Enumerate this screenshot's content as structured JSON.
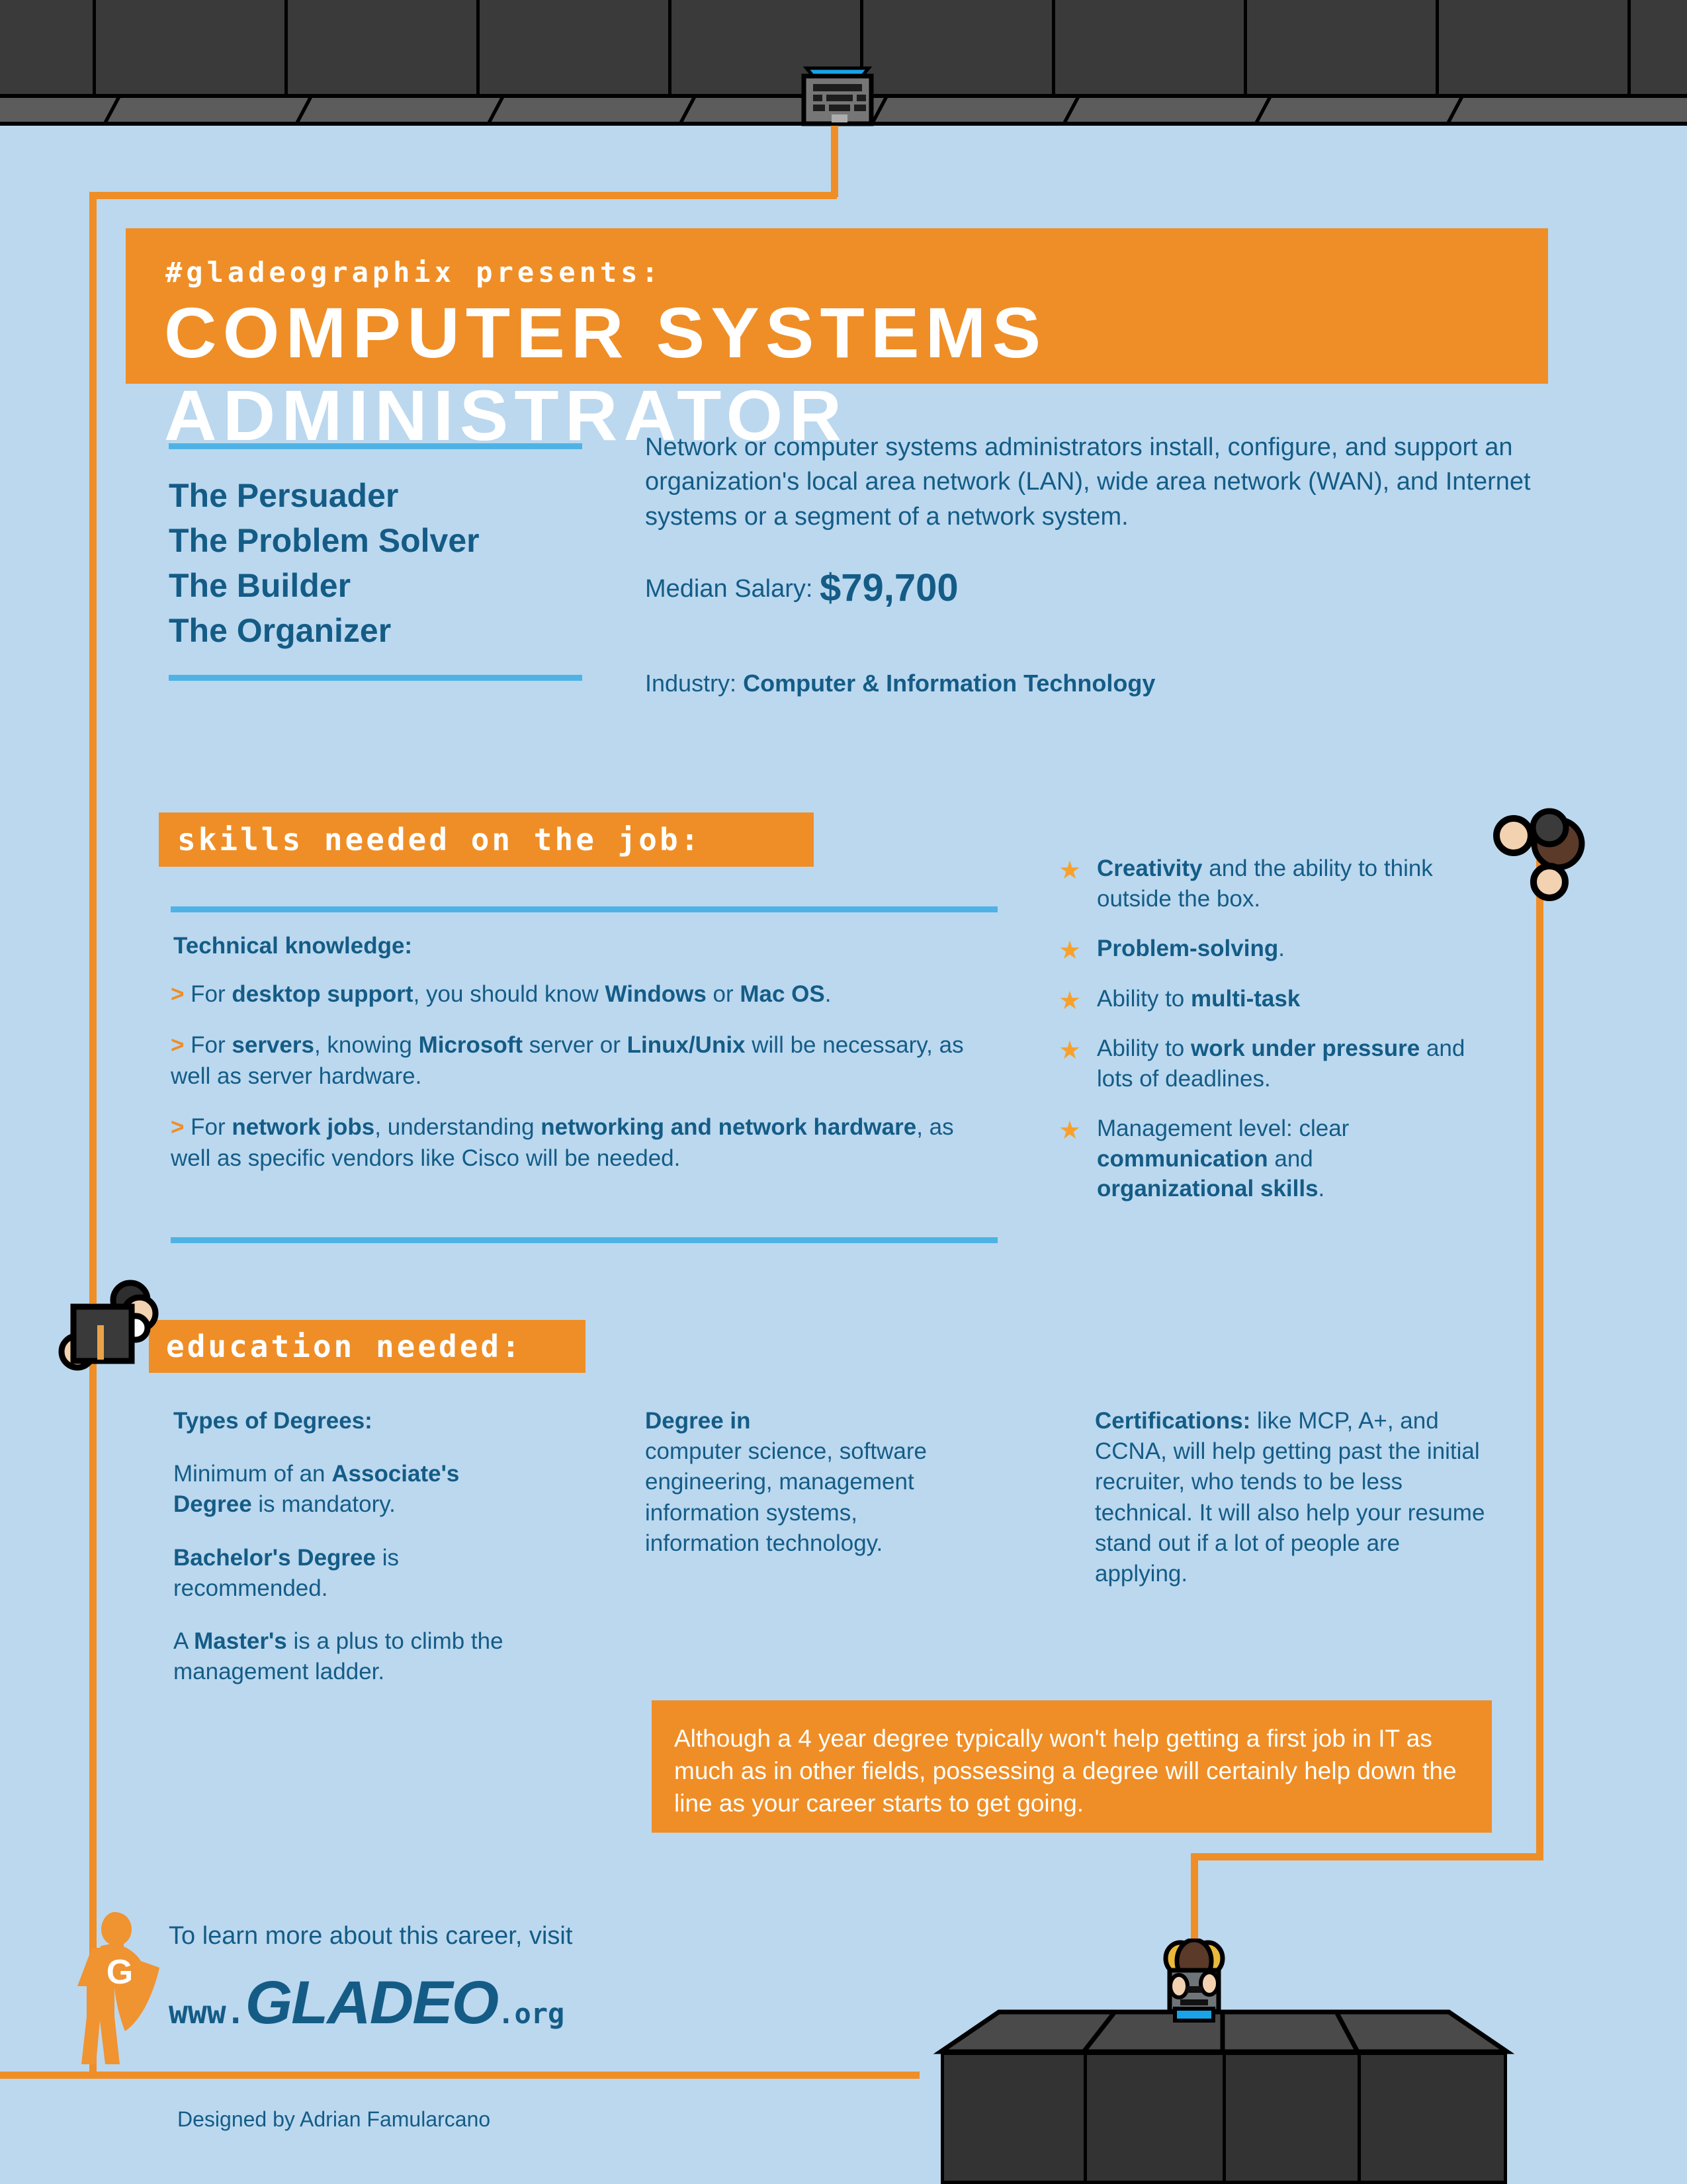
{
  "header": {
    "kicker": "#gladeographix presents:",
    "title": "COMPUTER SYSTEMS ADMINISTRATOR"
  },
  "personas": [
    "The Persuader",
    "The Problem Solver",
    "The Builder",
    "The Organizer"
  ],
  "overview": {
    "description": "Network or computer systems administrators install, configure, and support an organization's local area network (LAN), wide area network (WAN), and Internet systems or a segment of a network system.",
    "salary_label": "Median Salary:",
    "salary_value": "$79,700",
    "industry_label": "Industry:",
    "industry_value": "Computer & Information Technology"
  },
  "skills": {
    "heading": "skills needed on the job:",
    "technical_heading": "Technical knowledge:",
    "technical_items": [
      "For desktop support, you should know Windows or Mac OS.",
      "For servers, knowing Microsoft server or Linux/Unix will be necessary, as well as server hardware.",
      "For network jobs, understanding networking and network hardware, as well as specific vendors like Cisco will be needed."
    ],
    "soft_items": [
      "Creativity and the ability to think outside the box.",
      "Problem-solving.",
      "Ability to multi-task",
      "Ability to work under pressure and lots of deadlines.",
      "Management level: clear communication and organizational skills."
    ]
  },
  "education": {
    "heading": "education needed:",
    "col1_heading": "Types of Degrees:",
    "col1_items": [
      "Minimum of an Associate's Degree is mandatory.",
      "Bachelor's Degree is recommended.",
      "A Master's is a plus to climb the management ladder."
    ],
    "col2_heading": "Degree in",
    "col2_body": "computer science, software engineering, management information systems, information technology.",
    "col3_heading": "Certifications:",
    "col3_body": "like MCP, A+, and CCNA, will help getting past the initial recruiter, who tends to be less technical. It will also help your resume stand out if a lot of people are applying.",
    "callout": "Although a 4 year degree typically won't help getting a first job in IT as much as in other fields, possessing a degree will certainly help down the line as your career starts to get going."
  },
  "footer": {
    "cta": "To learn more about this career, visit",
    "url_prefix": "www.",
    "url_brand": "GLADEO",
    "url_suffix": ".org",
    "credit": "Designed by Adrian Famularcano",
    "logo_letter": "G"
  },
  "colors": {
    "background": "#bbd8ef",
    "orange": "#ef8e26",
    "blue_dark": "#145c86",
    "blue_rule": "#4eb3e4",
    "dark": "#3a3a3a",
    "cyan": "#19a3e8"
  }
}
